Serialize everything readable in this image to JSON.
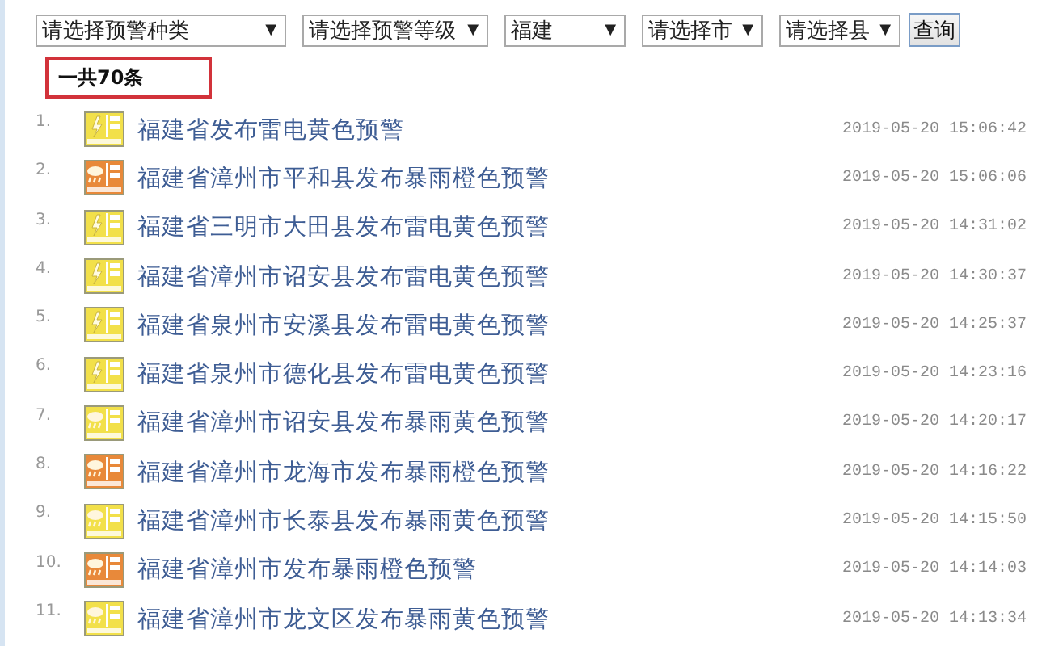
{
  "filters": [
    {
      "value": "请选择预警种类",
      "caret": "▼"
    },
    {
      "value": "请选择预警等级",
      "caret": "▼"
    },
    {
      "value": "福建",
      "caret": "▼"
    },
    {
      "value": "请选择市",
      "caret": "▼"
    },
    {
      "value": "请选择县",
      "caret": "▼"
    }
  ],
  "query_button": "查询",
  "total": "一共70条",
  "alerts": [
    {
      "number": "1.",
      "kind": "thunder",
      "color": "#f2e04a",
      "title": "福建省发布雷电黄色预警",
      "time": "2019-05-20 15:06:42"
    },
    {
      "number": "2.",
      "kind": "rainstorm",
      "color": "#e8893a",
      "title": "福建省漳州市平和县发布暴雨橙色预警",
      "time": "2019-05-20 15:06:06"
    },
    {
      "number": "3.",
      "kind": "thunder",
      "color": "#f2e04a",
      "title": "福建省三明市大田县发布雷电黄色预警",
      "time": "2019-05-20 14:31:02"
    },
    {
      "number": "4.",
      "kind": "thunder",
      "color": "#f2e04a",
      "title": "福建省漳州市诏安县发布雷电黄色预警",
      "time": "2019-05-20 14:30:37"
    },
    {
      "number": "5.",
      "kind": "thunder",
      "color": "#f2e04a",
      "title": "福建省泉州市安溪县发布雷电黄色预警",
      "time": "2019-05-20 14:25:37"
    },
    {
      "number": "6.",
      "kind": "thunder",
      "color": "#f2e04a",
      "title": "福建省泉州市德化县发布雷电黄色预警",
      "time": "2019-05-20 14:23:16"
    },
    {
      "number": "7.",
      "kind": "rainstorm",
      "color": "#f2e04a",
      "title": "福建省漳州市诏安县发布暴雨黄色预警",
      "time": "2019-05-20 14:20:17"
    },
    {
      "number": "8.",
      "kind": "rainstorm",
      "color": "#e8893a",
      "title": "福建省漳州市龙海市发布暴雨橙色预警",
      "time": "2019-05-20 14:16:22"
    },
    {
      "number": "9.",
      "kind": "rainstorm",
      "color": "#f2e04a",
      "title": "福建省漳州市长泰县发布暴雨黄色预警",
      "time": "2019-05-20 14:15:50"
    },
    {
      "number": "10.",
      "kind": "rainstorm",
      "color": "#e8893a",
      "title": "福建省漳州市发布暴雨橙色预警",
      "time": "2019-05-20 14:14:03"
    },
    {
      "number": "11.",
      "kind": "rainstorm",
      "color": "#f2e04a",
      "title": "福建省漳州市龙文区发布暴雨黄色预警",
      "time": "2019-05-20 14:13:34"
    }
  ]
}
